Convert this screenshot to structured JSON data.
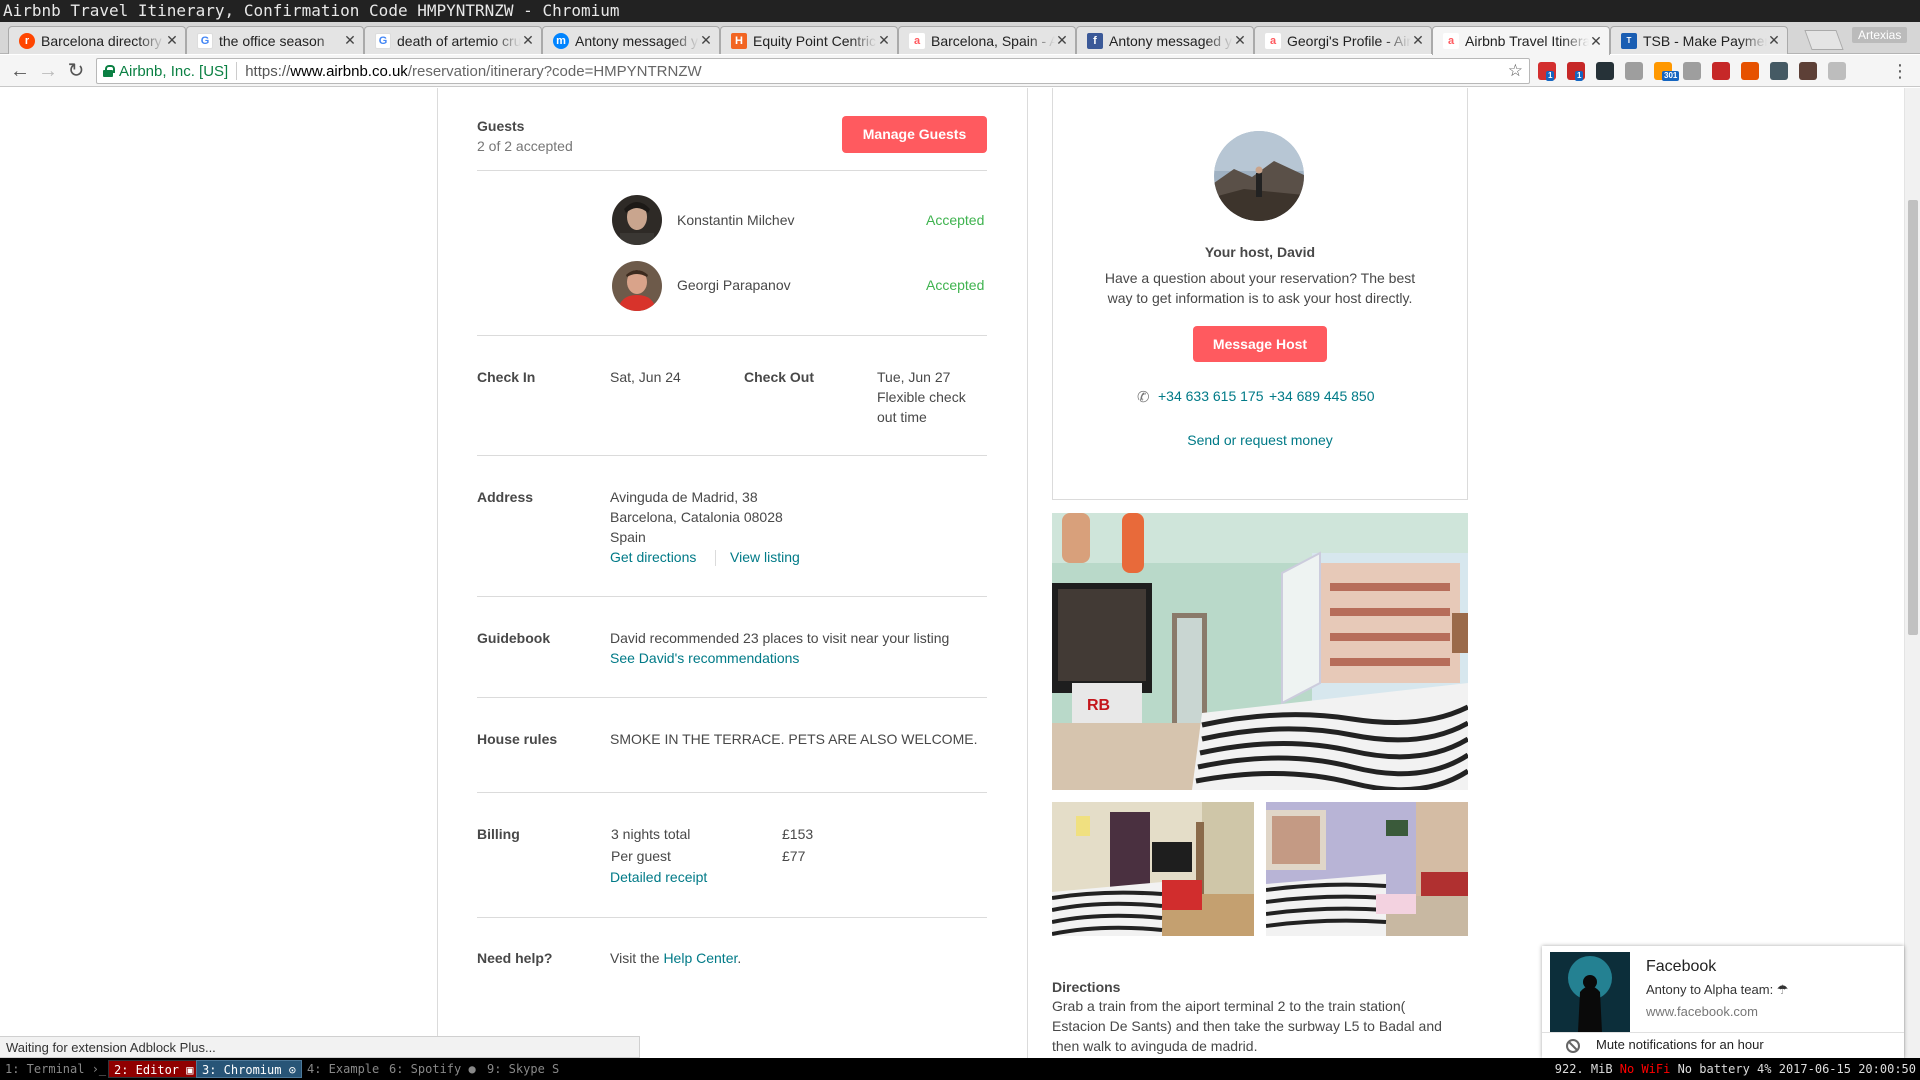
{
  "window": {
    "title": "Airbnb Travel Itinerary, Confirmation Code HMPYNTRNZW - Chromium"
  },
  "tabs": [
    {
      "title": "Barcelona directory",
      "icon": "reddit-icon",
      "color": "#ff4500",
      "glyph": "r"
    },
    {
      "title": "the office season",
      "icon": "google-icon",
      "color": "#4285f4",
      "glyph": "G"
    },
    {
      "title": "death of artemio cruz",
      "icon": "google-icon",
      "color": "#4285f4",
      "glyph": "G"
    },
    {
      "title": "Antony messaged you",
      "icon": "messenger-icon",
      "color": "#0084ff",
      "glyph": "m"
    },
    {
      "title": "Equity Point Centric",
      "icon": "hostel-icon",
      "color": "#f26522",
      "glyph": "H"
    },
    {
      "title": "Barcelona, Spain - Airbnb",
      "icon": "airbnb-icon",
      "color": "#ff5a5f",
      "glyph": "a"
    },
    {
      "title": "Antony messaged you",
      "icon": "facebook-icon",
      "color": "#3b5998",
      "glyph": "f"
    },
    {
      "title": "Georgi's Profile - Airbnb",
      "icon": "airbnb-icon",
      "color": "#ff5a5f",
      "glyph": "a"
    },
    {
      "title": "Airbnb Travel Itinerary",
      "icon": "airbnb-icon",
      "color": "#ff5a5f",
      "glyph": "a",
      "active": true
    },
    {
      "title": "TSB - Make Payment",
      "icon": "tsb-icon",
      "color": "#1a5eb3",
      "glyph": "T"
    }
  ],
  "profile": {
    "name": "Artexias"
  },
  "address_bar": {
    "secure_label": "Airbnb, Inc. [US]",
    "scheme": "https://",
    "host": "www.airbnb.co.uk",
    "path": "/reservation/itinerary?code=HMPYNTRNZW"
  },
  "extensions": [
    {
      "name": "abp-icon",
      "color": "#d32f2f",
      "badge": "1"
    },
    {
      "name": "ublock-icon",
      "color": "#c62828",
      "badge": "1"
    },
    {
      "name": "pocket-icon",
      "color": "#263238",
      "badge": ""
    },
    {
      "name": "screen-icon",
      "color": "#9e9e9e",
      "badge": ""
    },
    {
      "name": "rss-icon",
      "color": "#ff9800",
      "badge": "301"
    },
    {
      "name": "grey-icon",
      "color": "#9e9e9e",
      "badge": ""
    },
    {
      "name": "bookmark-icon",
      "color": "#c62828",
      "badge": ""
    },
    {
      "name": "alert-icon",
      "color": "#e65100",
      "badge": ""
    },
    {
      "name": "rocket-icon",
      "color": "#455a64",
      "badge": ""
    },
    {
      "name": "k-icon",
      "color": "#5d4037",
      "badge": ""
    },
    {
      "name": "ghost-icon",
      "color": "#bdbdbd",
      "badge": ""
    }
  ],
  "guests": {
    "label": "Guests",
    "summary": "2 of 2 accepted",
    "manage_button": "Manage Guests",
    "list": [
      {
        "name": "Konstantin Milchev",
        "status": "Accepted"
      },
      {
        "name": "Georgi Parapanov",
        "status": "Accepted"
      }
    ]
  },
  "dates": {
    "checkin_label": "Check In",
    "checkin_value": "Sat, Jun 24",
    "checkout_label": "Check Out",
    "checkout_line1": "Tue, Jun 27",
    "checkout_line2": "Flexible check",
    "checkout_line3": "out time"
  },
  "address": {
    "label": "Address",
    "line1": "Avinguda de Madrid, 38",
    "line2": "Barcelona, Catalonia 08028",
    "line3": "Spain",
    "directions_link": "Get directions",
    "listing_link": "View listing"
  },
  "guidebook": {
    "label": "Guidebook",
    "text": "David recommended 23 places to visit near your listing",
    "link": "See David's recommendations"
  },
  "house_rules": {
    "label": "House rules",
    "text": "SMOKE IN THE TERRACE. PETS ARE ALSO WELCOME."
  },
  "billing": {
    "label": "Billing",
    "nights_label": "3 nights total",
    "nights_value": "£153",
    "per_guest_label": "Per guest",
    "per_guest_value": "£77",
    "receipt_link": "Detailed receipt"
  },
  "help": {
    "label": "Need help?",
    "prefix": "Visit the ",
    "link": "Help Center",
    "suffix": "."
  },
  "host": {
    "title": "Your host, David",
    "line1": "Have a question about your reservation? The best",
    "line2": "way to get information is to ask your host directly.",
    "message_button": "Message Host",
    "phone1": "+34 633 615 175",
    "phone2": "+34 689 445 850",
    "money_link": "Send or request money"
  },
  "directions": {
    "label": "Directions",
    "line1": "Grab a train from the aiport terminal 2 to the train station(",
    "line2": "Estacion De Sants) and then take the surbway L5 to Badal and",
    "line3": "then walk to avinguda de madrid."
  },
  "status_bar": {
    "text": "Waiting for extension Adblock Plus..."
  },
  "notification": {
    "title": "Facebook",
    "body": "Antony to Alpha team: ☂",
    "source": "www.facebook.com",
    "mute": "Mute notifications for an hour"
  },
  "i3": {
    "workspaces": [
      {
        "label": "1: Terminal ›_",
        "state": "normal"
      },
      {
        "label": "2: Editor ▣",
        "state": "urgent"
      },
      {
        "label": "3: Chromium ⊙",
        "state": "focused"
      },
      {
        "label": "4: Example",
        "state": "normal"
      },
      {
        "label": "6: Spotify ●",
        "state": "normal"
      },
      {
        "label": "9: Skype S",
        "state": "normal"
      }
    ],
    "status_left": "922.",
    "status_mid": " MiB ",
    "status_red": "No WiFi",
    "status_right": " No battery  4%  2017-06-15 20:00:50"
  },
  "colors": {
    "accent": "#ff5a5f",
    "link": "#007a87",
    "accepted": "#3fb34f"
  }
}
